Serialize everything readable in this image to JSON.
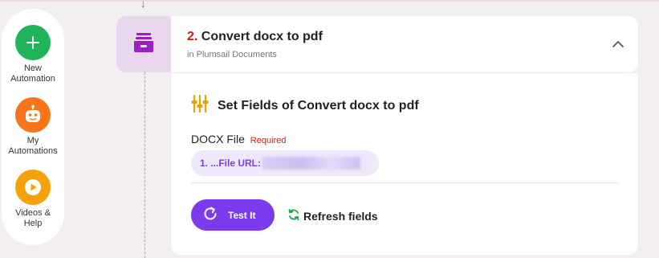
{
  "sidebar": {
    "items": [
      {
        "label": "New\nAutomation",
        "icon": "plus-icon",
        "color": "#1fb35a"
      },
      {
        "label": "My\nAutomations",
        "icon": "robot-icon",
        "color": "#f5761a"
      },
      {
        "label": "Videos &\nHelp",
        "icon": "play-icon",
        "color": "#f5a10a"
      }
    ]
  },
  "step": {
    "number": "2.",
    "title": "Convert docx to pdf",
    "subtitle": "in Plumsail Documents",
    "app_icon": "archive-drawer-icon",
    "app_color": "#9b1fc4"
  },
  "section": {
    "title": "Set Fields of Convert docx to pdf",
    "icon": "sliders-icon"
  },
  "field": {
    "label": "DOCX File",
    "required": "Required",
    "value": "1. ...File URL:"
  },
  "actions": {
    "test": "Test It",
    "refresh": "Refresh fields"
  },
  "colors": {
    "accent": "#7c3aed",
    "required": "#cc1a1a",
    "refresh": "#19a84a"
  }
}
